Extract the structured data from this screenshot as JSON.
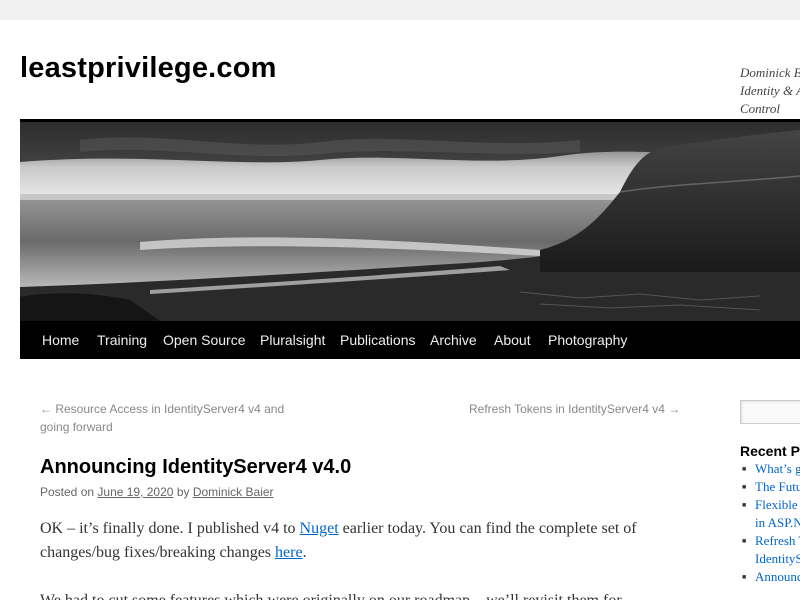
{
  "header": {
    "site_title": "leastprivilege.com",
    "site_description": "Dominick Baier on Identity & Access Control"
  },
  "nav": {
    "items": [
      "Home",
      "Training",
      "Open Source",
      "Pluralsight",
      "Publications",
      "Archive",
      "About",
      "Photography"
    ]
  },
  "post_nav": {
    "previous": "← Resource Access in IdentityServer4 v4 and going forward",
    "next": "Refresh Tokens in IdentityServer4 v4 →"
  },
  "post": {
    "title": "Announcing IdentityServer4 v4.0",
    "posted_on_label": "Posted on",
    "date": "June 19, 2020",
    "by_label": "by",
    "author": "Dominick Baier",
    "p1_part1": "OK – it’s finally done. I published v4 to ",
    "p1_link1": "Nuget",
    "p1_part2": " earlier today. You can find the complete set of changes/bug fixes/breaking changes ",
    "p1_link2": "here",
    "p1_part3": ".",
    "p2_text": "We had to cut some features which were originally on our roadmap – we’ll revisit them for"
  },
  "sidebar": {
    "search_placeholder": "",
    "recent_title": "Recent Posts",
    "recent_posts": [
      "What’s good",
      "The Future",
      "Flexible",
      "in ASP.NET",
      "Refresh T",
      "IdentityS",
      "Announc"
    ]
  },
  "colors": {
    "link": "#0066cc",
    "nav_bg": "#000000",
    "page_bg": "#f1f1f1"
  }
}
